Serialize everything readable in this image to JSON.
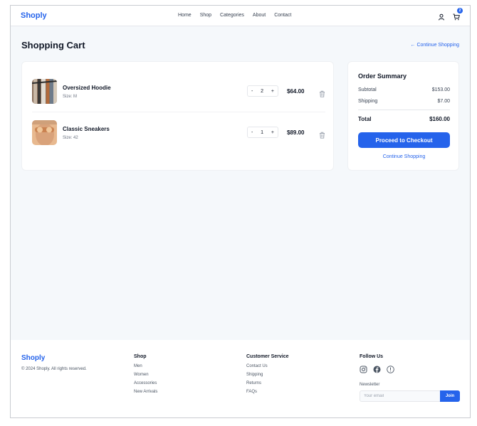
{
  "header": {
    "logo": "Shoply",
    "nav": [
      "Home",
      "Shop",
      "Categories",
      "About",
      "Contact"
    ],
    "cart_count": "2",
    "icons": [
      "user-icon",
      "cart-icon"
    ]
  },
  "page": {
    "title": "Shopping Cart",
    "continue_link": "← Continue Shopping"
  },
  "cart": {
    "items": [
      {
        "name": "Oversized Hoodie",
        "size": "Size: M",
        "qty_minus": "-",
        "quantity": "2",
        "qty_plus": "+",
        "price": "$64.00"
      },
      {
        "name": "Classic Sneakers",
        "size": "Size: 42",
        "qty_minus": "-",
        "quantity": "1",
        "qty_plus": "+",
        "price": "$89.00"
      }
    ]
  },
  "summary": {
    "title": "Order Summary",
    "subtotal_label": "Subtotal",
    "subtotal_value": "$153.00",
    "shipping_label": "Shipping",
    "shipping_value": "$7.00",
    "total_label": "Total",
    "total_value": "$160.00",
    "checkout_label": "Proceed to Checkout",
    "continue_label": "Continue Shopping"
  },
  "footer": {
    "logo": "Shoply",
    "copyright": "© 2024 Shoply. All rights reserved.",
    "shop": {
      "heading": "Shop",
      "links": [
        "Men",
        "Women",
        "Accessories",
        "New Arrivals"
      ]
    },
    "service": {
      "heading": "Customer Service",
      "links": [
        "Contact Us",
        "Shipping",
        "Returns",
        "FAQs"
      ]
    },
    "follow": {
      "heading": "Follow Us",
      "icons": [
        "instagram-icon",
        "facebook-icon",
        "pinterest-icon"
      ],
      "newsletter_label": "Newsletter",
      "email_placeholder": "Your email",
      "join_label": "Join"
    }
  },
  "colors": {
    "accent": "#2563eb",
    "background": "#f5f8fb",
    "card": "#ffffff"
  }
}
